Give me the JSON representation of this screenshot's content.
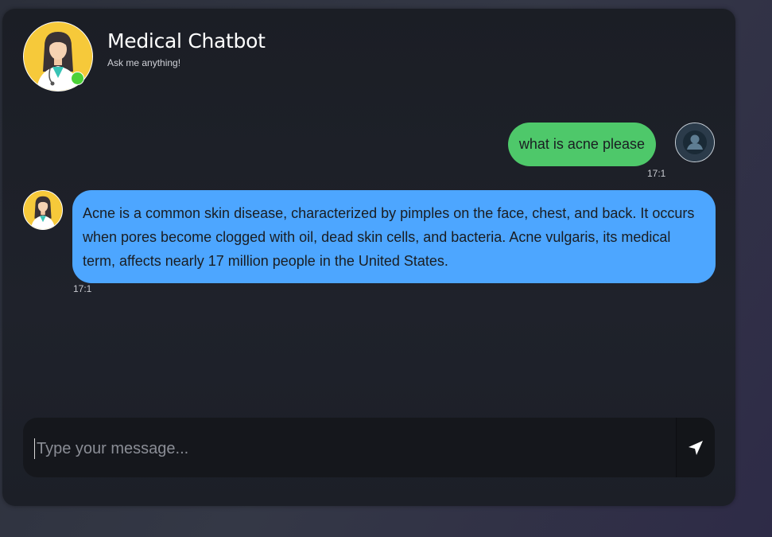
{
  "header": {
    "title": "Medical Chatbot",
    "subtitle": "Ask me anything!",
    "status": "online",
    "status_color": "#4cd137",
    "avatar_icon": "doctor-avatar-icon"
  },
  "messages": [
    {
      "sender": "user",
      "text": "what is acne please",
      "time": "17:1",
      "bubble_color": "#4ec86a",
      "avatar_icon": "user-avatar-icon"
    },
    {
      "sender": "bot",
      "text": "Acne is a common skin disease, characterized by pimples on the face, chest, and back. It occurs when pores become clogged with oil, dead skin cells, and bacteria. Acne vulgaris, its medical term, affects nearly 17 million people in the United States.",
      "time": "17:1",
      "bubble_color": "#4da6ff",
      "avatar_icon": "doctor-avatar-icon"
    }
  ],
  "composer": {
    "placeholder": "Type your message...",
    "value": "",
    "send_icon": "send-icon"
  }
}
